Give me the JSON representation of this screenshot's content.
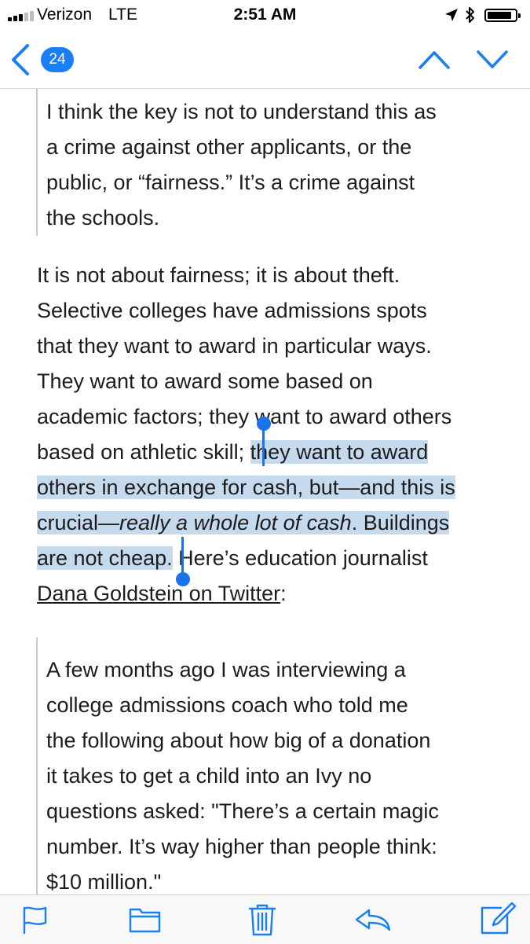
{
  "status_bar": {
    "carrier": "Verizon",
    "network": "LTE",
    "time": "2:51 AM",
    "icons": [
      "signal-bars-icon",
      "location-arrow-icon",
      "bluetooth-icon",
      "battery-icon"
    ]
  },
  "nav": {
    "back_icon": "chevron-left-icon",
    "unread_count": "24",
    "prev_icon": "chevron-up-icon",
    "next_icon": "chevron-down-icon",
    "accent_color": "#1a7ef5"
  },
  "quote_1": {
    "lines": [
      "I think the key is not to understand this as",
      "a crime against other applicants, or the",
      "public, or “fairness.” It’s a crime against",
      "the schools."
    ]
  },
  "body": {
    "line_1": "It is not about fairness; it is about theft.",
    "line_2": "Selective colleges have admissions spots",
    "line_3": "that they want to award in particular ways.",
    "line_4": "They want to award some based on",
    "line_5": "academic factors; they want to award others",
    "line_6_plain": "based on athletic skill; ",
    "line_6_selected": "they want to award",
    "line_7_selected": "others in exchange for cash, but—and this is",
    "line_8_selected_a": "crucial—",
    "line_8_selected_italic": "really a whole lot of cash",
    "line_8_selected_b": ". Buildings",
    "line_9_selected": "are not cheap.",
    "line_9_plain": " Here’s education journalist",
    "link_text": "Dana Goldstein on Twitter",
    "after_link": ":",
    "selection_color": "#c6daee"
  },
  "quote_2": {
    "lines": [
      "A few months ago I was interviewing a",
      "college admissions coach who told me",
      "the following about how big of a donation",
      "it takes to get a child into an Ivy no",
      "questions asked: \"There’s a certain magic",
      "number. It’s way higher than people think:",
      "$10 million.\""
    ]
  },
  "toolbar": {
    "items": [
      "flag-icon",
      "folder-icon",
      "trash-icon",
      "reply-icon",
      "compose-icon"
    ],
    "tint": "#1a7ef5"
  }
}
